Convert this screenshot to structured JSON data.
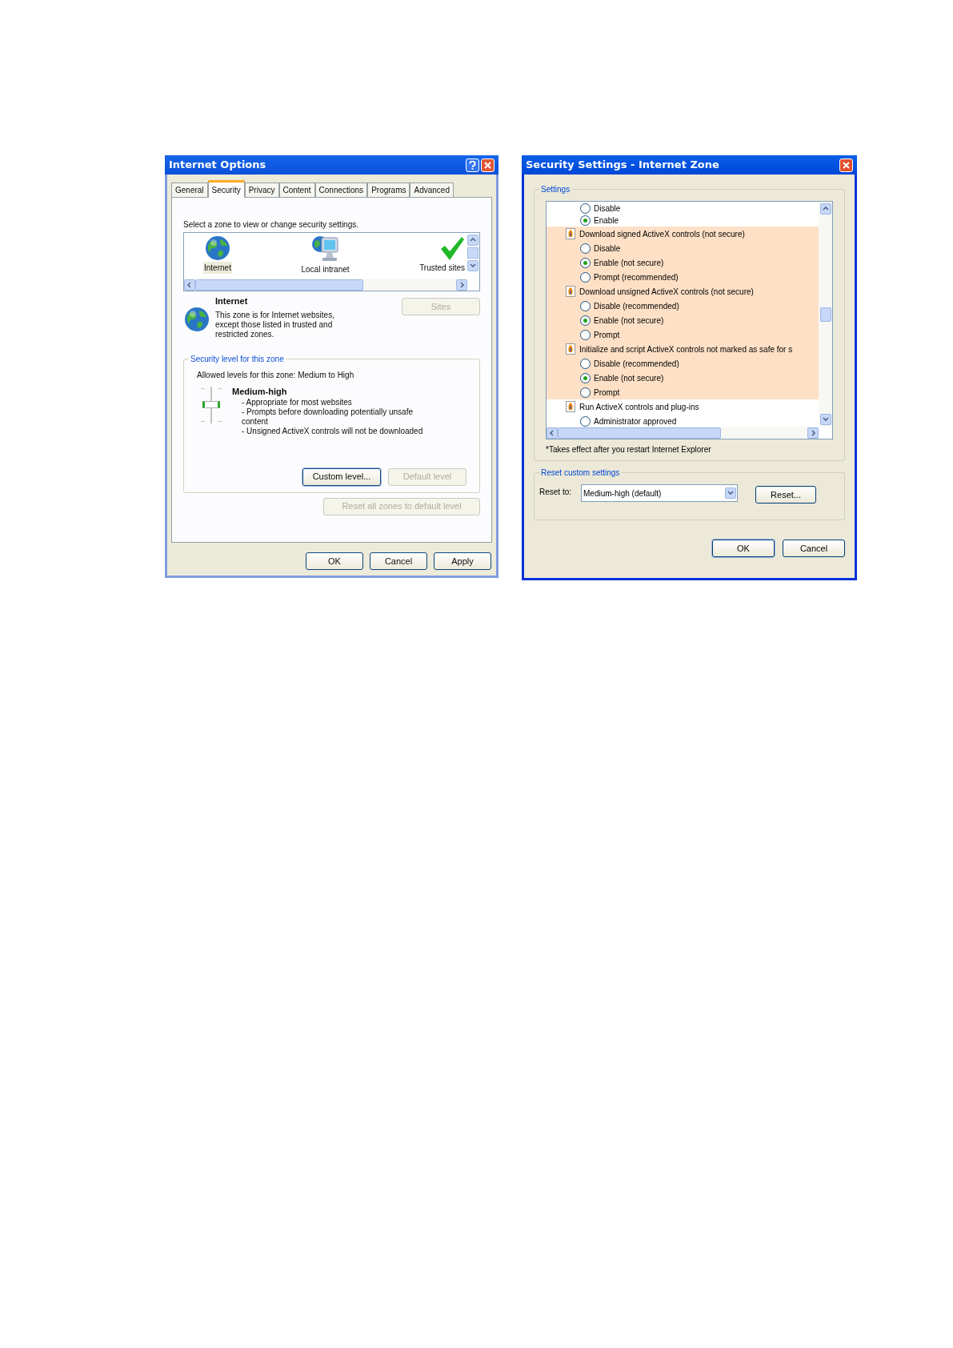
{
  "internet_options": {
    "title": "Internet Options",
    "tabs": [
      {
        "label": "General",
        "selected": false
      },
      {
        "label": "Security",
        "selected": true
      },
      {
        "label": "Privacy",
        "selected": false
      },
      {
        "label": "Content",
        "selected": false
      },
      {
        "label": "Connections",
        "selected": false
      },
      {
        "label": "Programs",
        "selected": false
      },
      {
        "label": "Advanced",
        "selected": false
      }
    ],
    "zone_prompt": "Select a zone to view or change security settings.",
    "zones": [
      {
        "kind": "globe",
        "label": "Internet",
        "selected": true
      },
      {
        "kind": "computer",
        "label": "Local intranet",
        "selected": false
      },
      {
        "kind": "check",
        "label": "Trusted sites",
        "selected": false
      }
    ],
    "zone_info": {
      "name": "Internet",
      "description": "This zone is for Internet websites, except those listed in trusted and restricted zones."
    },
    "sites_button": {
      "label": "Sites",
      "disabled": true
    },
    "security_level": {
      "legend": "Security level for this zone",
      "allowed": "Allowed levels for this zone: Medium to High",
      "level": 0.5,
      "level_name": "Medium-high",
      "bullets": [
        "- Appropriate for most websites",
        "- Prompts before downloading potentially unsafe content",
        "- Unsigned ActiveX controls will not be downloaded"
      ],
      "buttons": [
        {
          "label": "Custom level...",
          "disabled": false
        },
        {
          "label": "Default level",
          "disabled": true
        }
      ]
    },
    "reset_all_button": {
      "label": "Reset all zones to default level",
      "disabled": true
    },
    "buttons": [
      "OK",
      "Cancel",
      "Apply"
    ]
  },
  "security_settings": {
    "title": "Security Settings - Internet Zone",
    "settings_legend": "Settings",
    "settings": [
      {
        "kind": "option",
        "label": "Disable",
        "selected": false
      },
      {
        "kind": "option",
        "label": "Enable",
        "selected": true
      },
      {
        "kind": "group",
        "label": "Download signed ActiveX controls (not secure)",
        "highlighted": true,
        "children": [
          {
            "label": "Disable",
            "selected": false
          },
          {
            "label": "Enable (not secure)",
            "selected": true
          },
          {
            "label": "Prompt (recommended)",
            "selected": false
          }
        ]
      },
      {
        "kind": "group",
        "label": "Download unsigned ActiveX controls (not secure)",
        "highlighted": true,
        "children": [
          {
            "label": "Disable (recommended)",
            "selected": false
          },
          {
            "label": "Enable (not secure)",
            "selected": true
          },
          {
            "label": "Prompt",
            "selected": false
          }
        ]
      },
      {
        "kind": "group",
        "label": "Initialize and script ActiveX controls not marked as safe for s",
        "highlighted": true,
        "children": [
          {
            "label": "Disable (recommended)",
            "selected": false
          },
          {
            "label": "Enable (not secure)",
            "selected": true
          },
          {
            "label": "Prompt",
            "selected": false
          }
        ]
      },
      {
        "kind": "group",
        "label": "Run ActiveX controls and plug-ins",
        "highlighted": false,
        "children": [
          {
            "label": "Administrator approved",
            "selected": false
          }
        ]
      }
    ],
    "footnote": "*Takes effect after you restart Internet Explorer",
    "reset_legend": "Reset custom settings",
    "reset_to_label": "Reset to:",
    "reset_to_value": "Medium-high (default)",
    "reset_button": "Reset...",
    "buttons": [
      "OK",
      "Cancel"
    ]
  }
}
